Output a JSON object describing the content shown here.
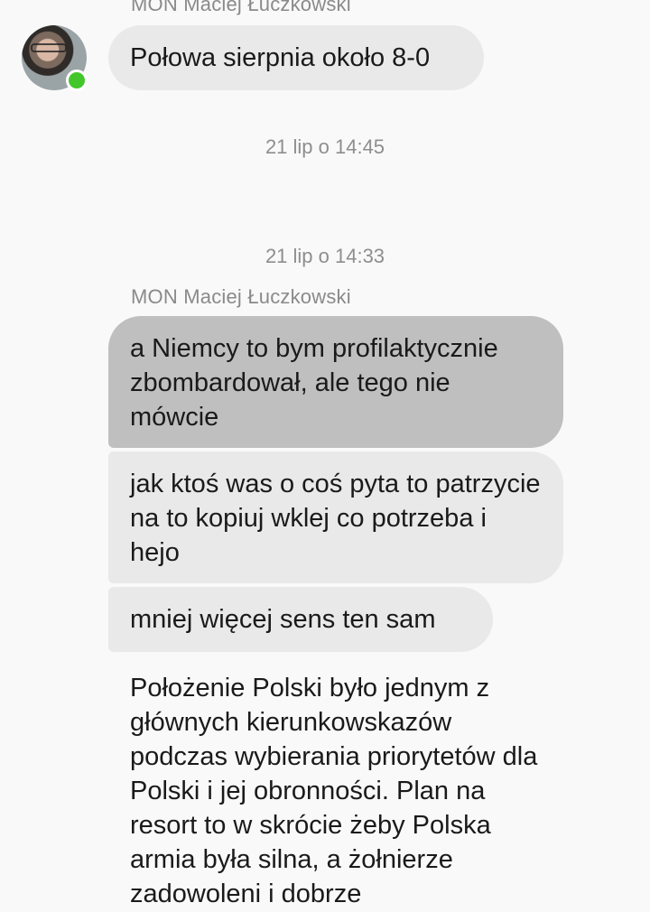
{
  "conversation": {
    "sender_top": "MON Maciej Łuczkowski",
    "message_1": "Połowa sierpnia około 8-0",
    "timestamp_1": "21 lip o 14:45",
    "timestamp_2": "21 lip o 14:33",
    "sender_2": "MON Maciej Łuczkowski",
    "message_2": "a Niemcy to bym profilaktycznie zbombardował, ale tego nie mówcie",
    "message_3": "jak ktoś was o coś pyta to patrzycie na to kopiuj wklej co potrzeba i hejo",
    "message_4": "mniej więcej sens ten sam",
    "message_5": "Położenie Polski było jednym z głównych kierunkowskazów podczas wybierania priorytetów dla Polski i jej obronności. Plan na resort to w skrócie żeby Polska armia była silna, a żołnierze zadowoleni i dobrze"
  },
  "avatar": {
    "icon": "profile-photo",
    "online_color": "#42c62a"
  },
  "colors": {
    "background": "#f9f9f9",
    "bubble_light": "#e9e9e9",
    "bubble_selected": "#bfbfbf",
    "meta_text": "#8e8e8e"
  }
}
